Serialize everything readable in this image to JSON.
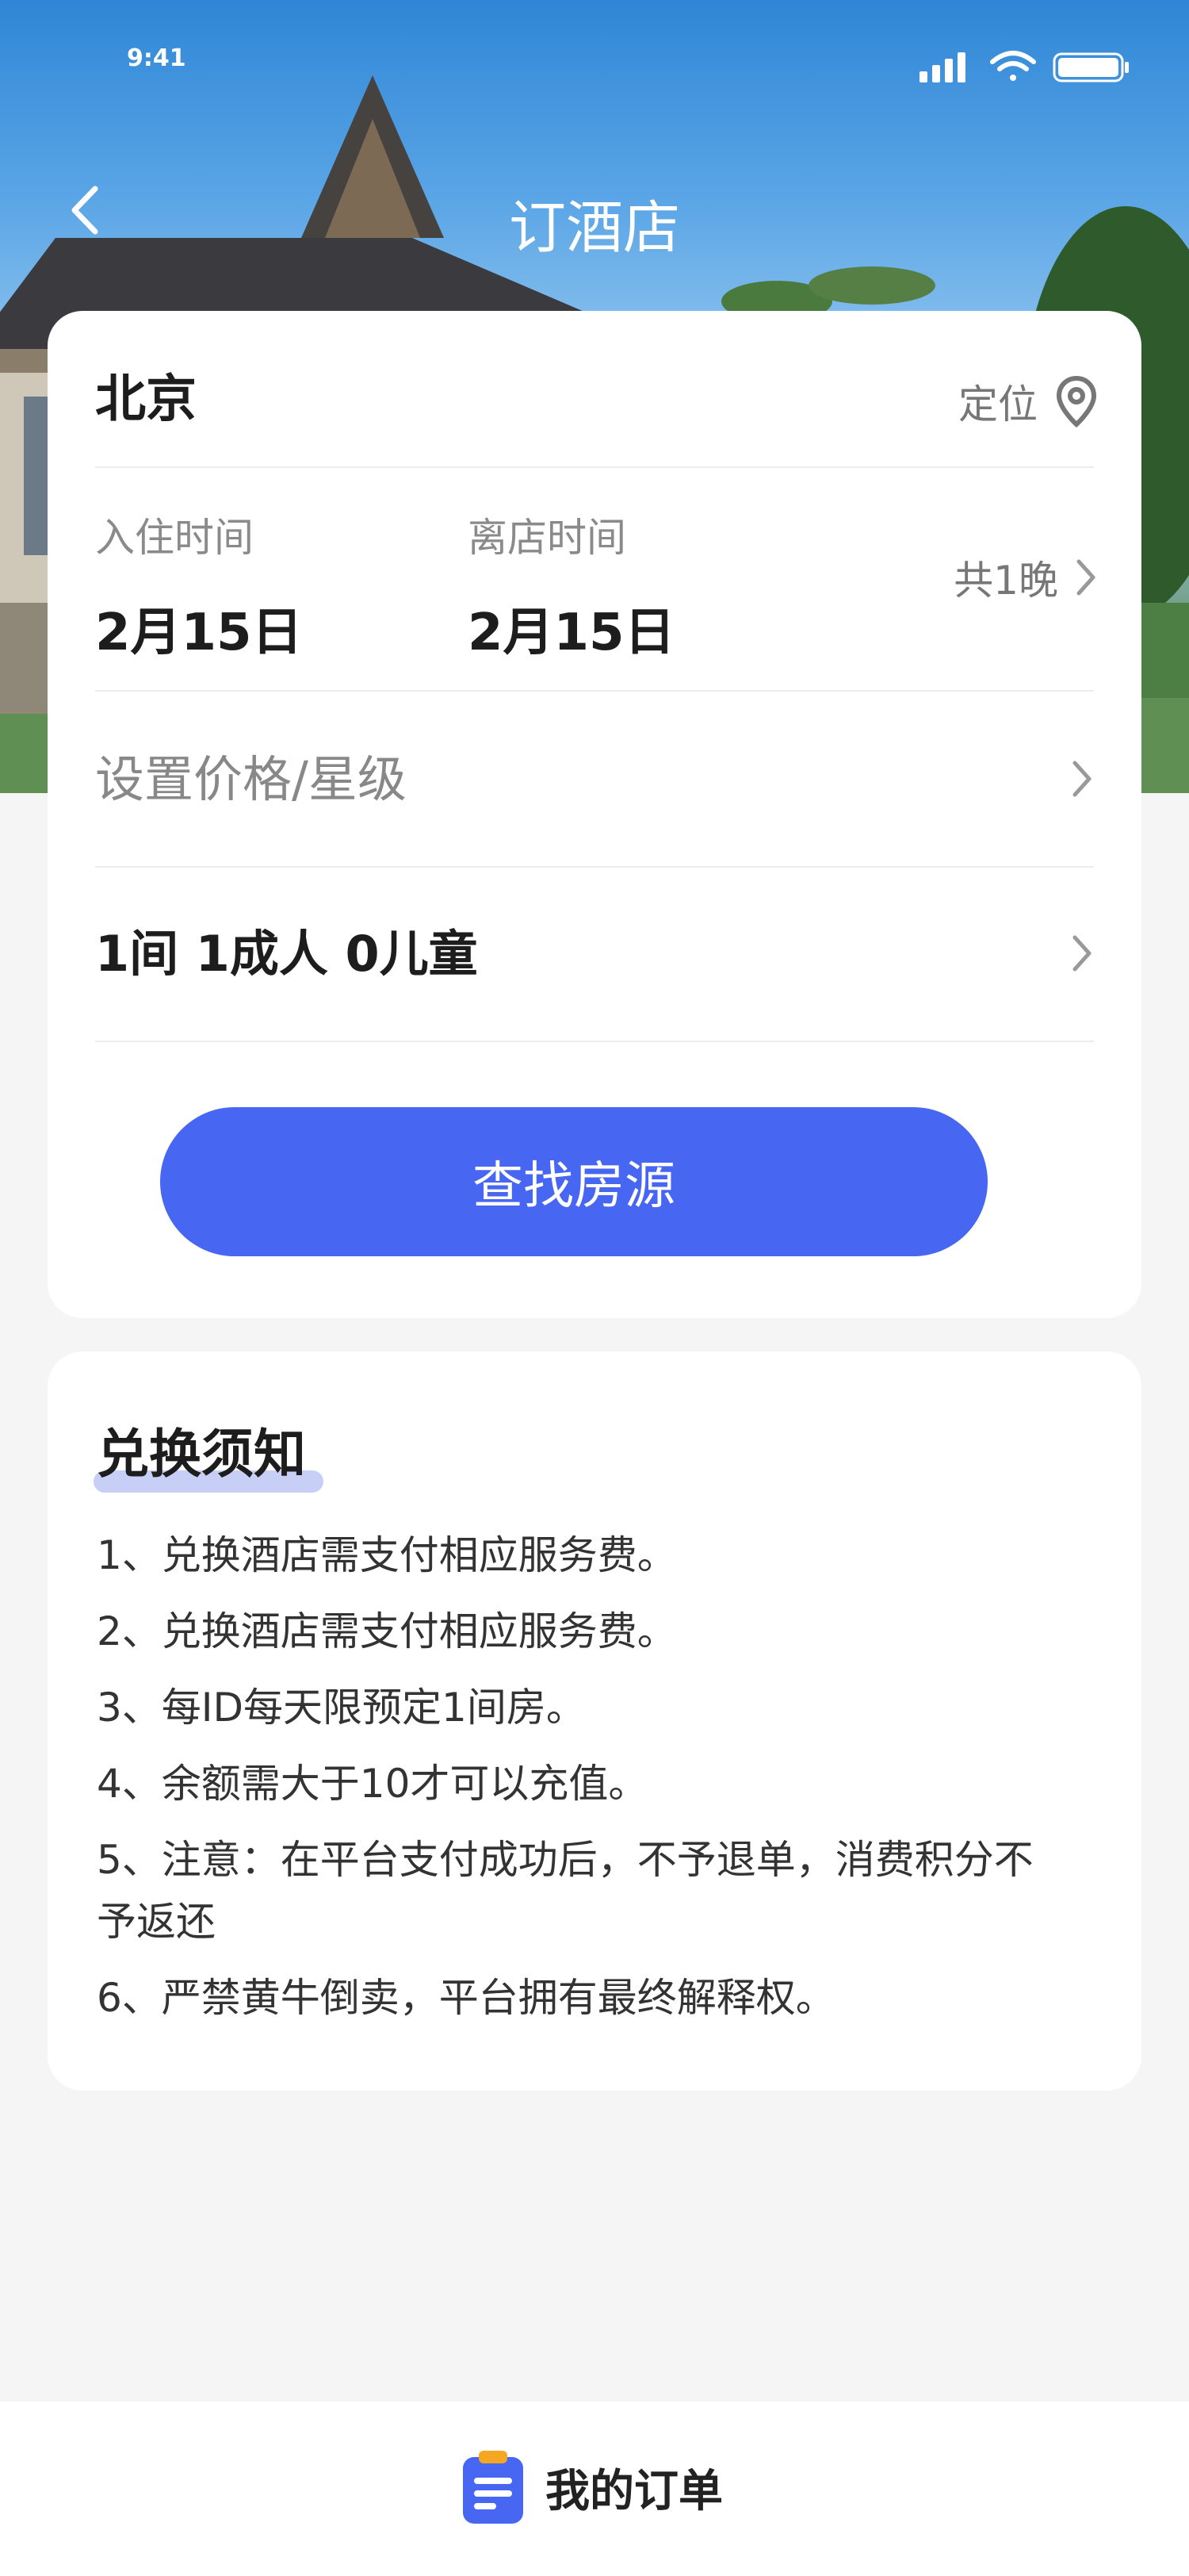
{
  "status_bar": {
    "time": "9:41"
  },
  "header": {
    "title": "订酒店"
  },
  "search": {
    "city": "北京",
    "locate_label": "定位",
    "checkin_label": "入住时间",
    "checkin_date": "2月15日",
    "checkout_label": "离店时间",
    "checkout_date": "2月15日",
    "nights": "共1晚",
    "price_placeholder": "设置价格/星级",
    "guests": "1间 1成人 0儿童",
    "submit_label": "查找房源"
  },
  "notice": {
    "title": "兑换须知",
    "items": [
      "1、兑换酒店需支付相应服务费。",
      "2、兑换酒店需支付相应服务费。",
      "3、每ID每天限预定1间房。",
      "4、余额需大于10才可以充值。",
      "5、注意：在平台支付成功后，不予退单，消费积分不予返还",
      "6、严禁黄牛倒卖，平台拥有最终解释权。"
    ]
  },
  "bottom_bar": {
    "orders_label": "我的订单"
  },
  "colors": {
    "accent": "#4766f2",
    "notice_underline": "#c7cff6",
    "order_icon_top": "#f5a623"
  },
  "icons": [
    "back-chevron-icon",
    "location-pin-icon",
    "chevron-right-icon",
    "order-list-icon",
    "signal-icon",
    "wifi-icon",
    "battery-icon"
  ]
}
